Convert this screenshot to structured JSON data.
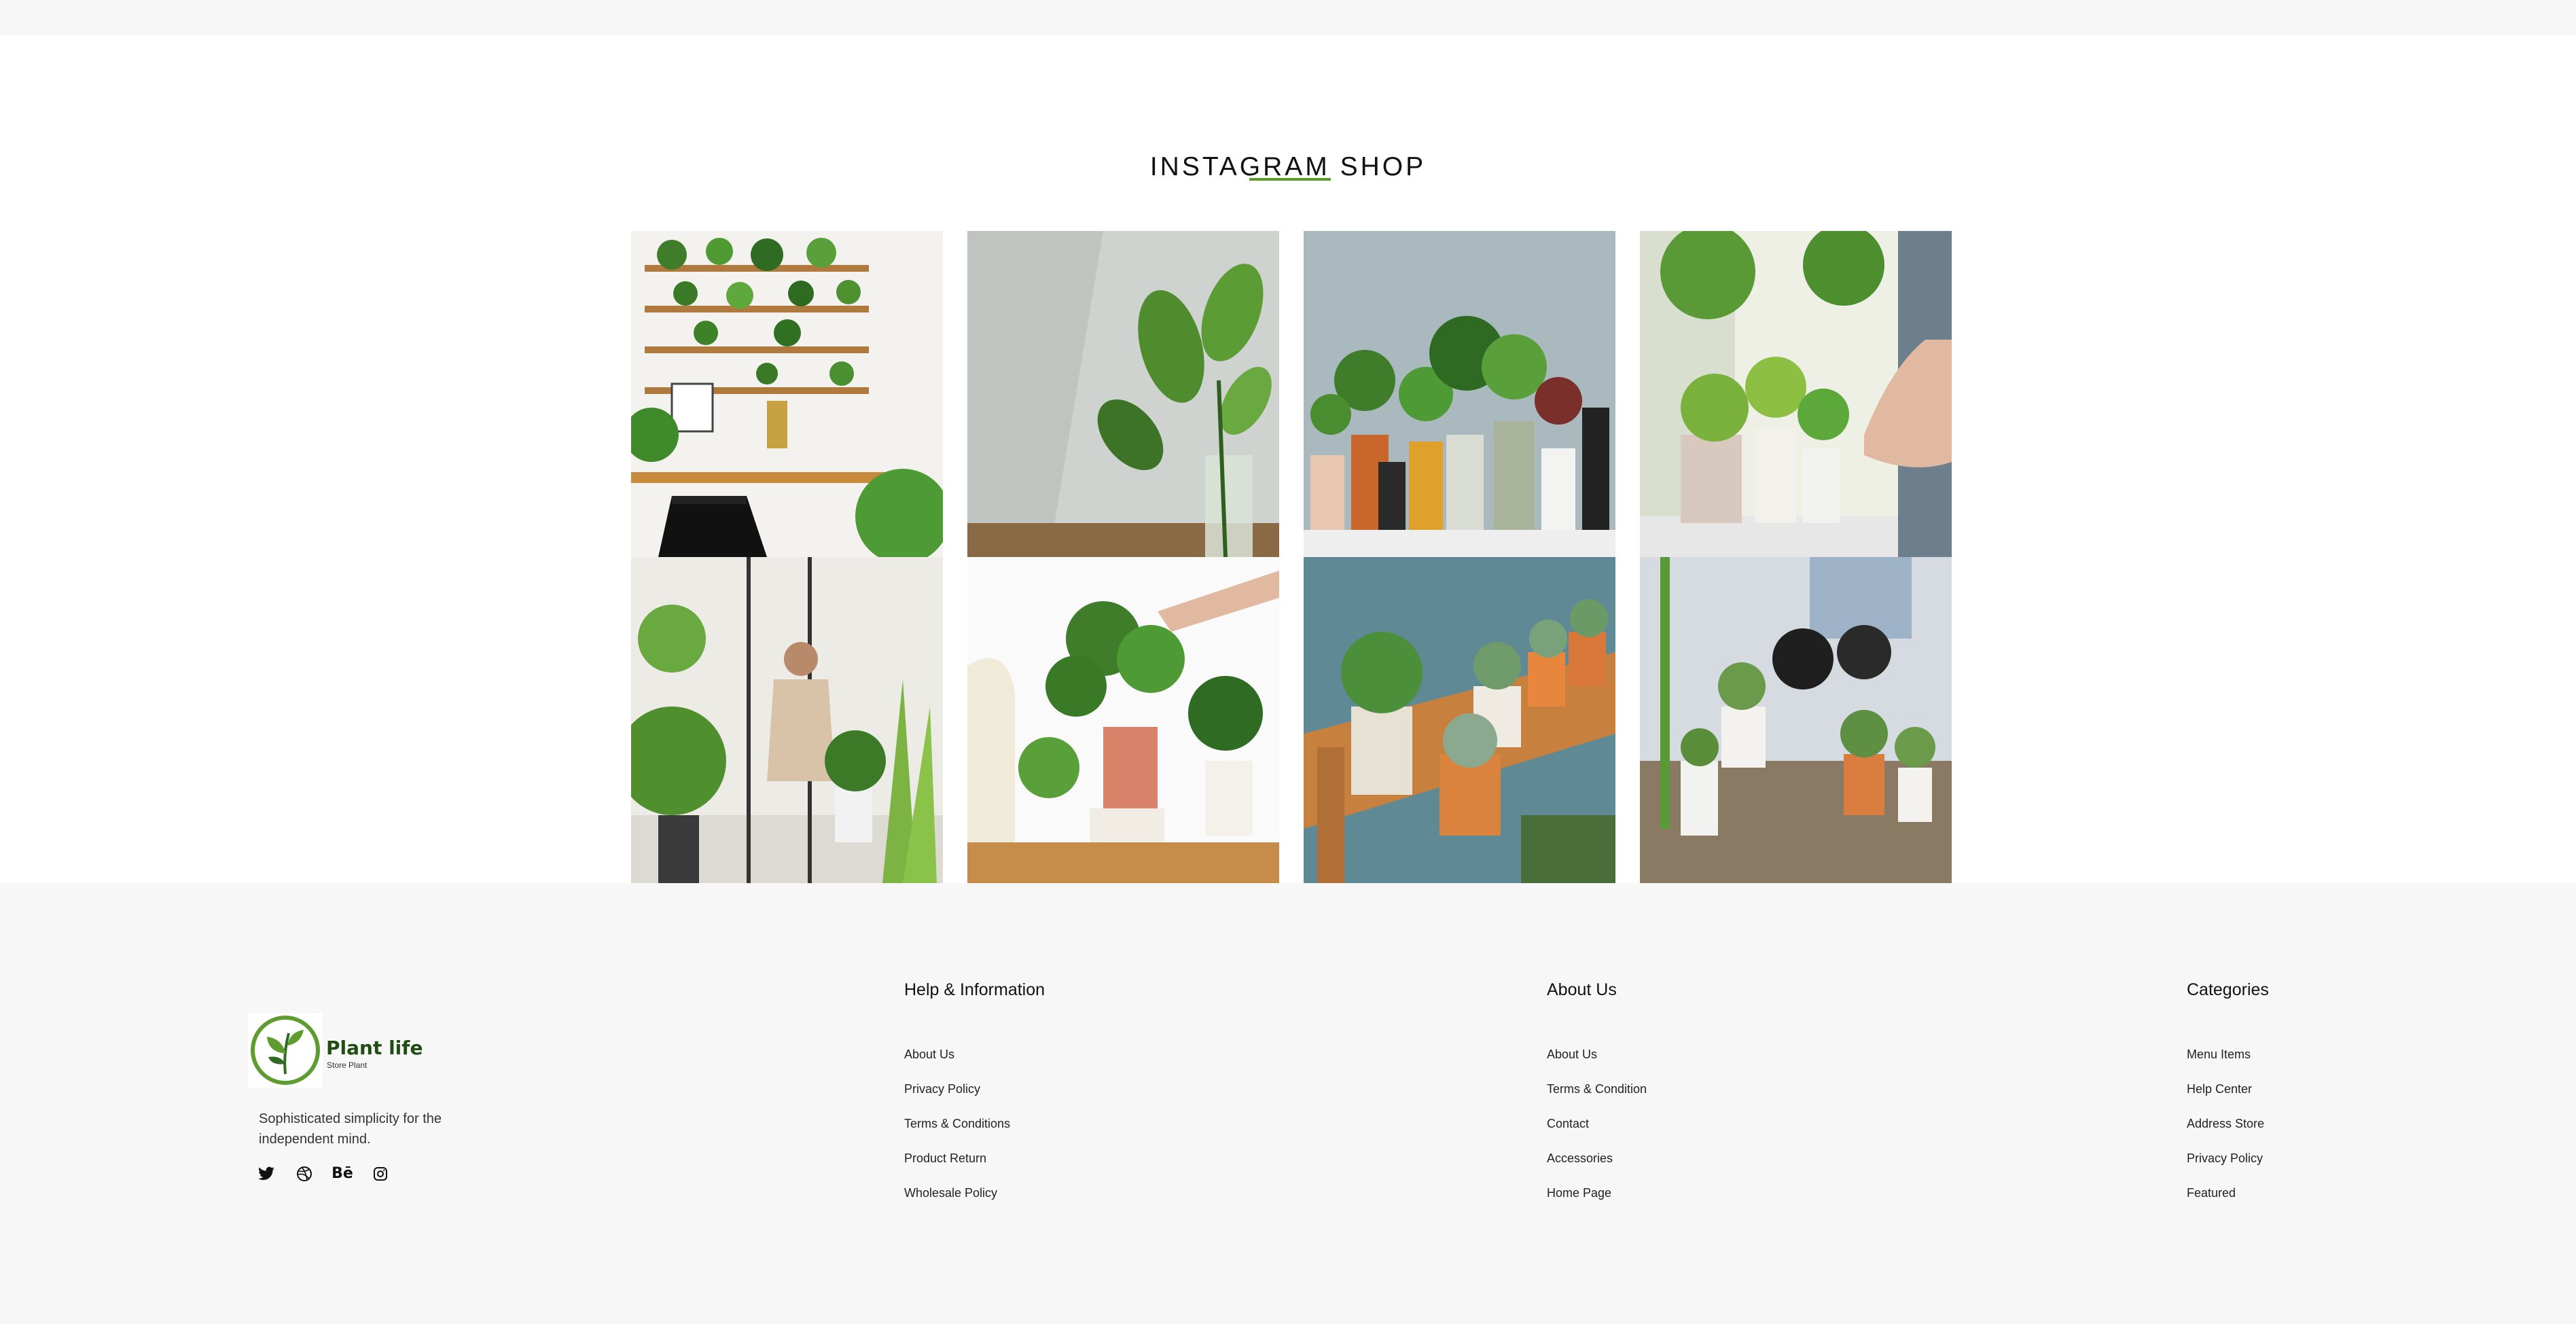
{
  "instagram": {
    "title": "INSTAGRAM SHOP",
    "accent_color": "#5f9c2f",
    "tiles": [
      {
        "name": "plant-shelf-desk-photo"
      },
      {
        "name": "leaf-in-glass-vase-photo"
      },
      {
        "name": "potted-plants-row-photo"
      },
      {
        "name": "hand-arranging-plants-photo"
      },
      {
        "name": "man-tending-plants-photo"
      },
      {
        "name": "hand-watering-monstera-photo"
      },
      {
        "name": "succulents-on-stand-photo"
      },
      {
        "name": "gloved-hands-cactus-photo"
      }
    ]
  },
  "footer": {
    "brand": {
      "name": "Plant life",
      "subtitle": "Store Plant",
      "tagline": "Sophisticated simplicity for the independent mind.",
      "logo_color": "#5f9c2f"
    },
    "socials": [
      {
        "name": "twitter-icon"
      },
      {
        "name": "dribbble-icon"
      },
      {
        "name": "behance-icon",
        "label": "Bē"
      },
      {
        "name": "instagram-icon"
      }
    ],
    "columns": [
      {
        "title": "Help & Information",
        "links": [
          "About Us",
          "Privacy Policy",
          "Terms & Conditions",
          "Product Return",
          "Wholesale Policy"
        ]
      },
      {
        "title": "About Us",
        "links": [
          "About Us",
          "Terms & Condition",
          "Contact",
          "Accessories",
          "Home Page"
        ]
      },
      {
        "title": "Categories",
        "links": [
          "Menu Items",
          "Help Center",
          "Address Store",
          "Privacy Policy",
          "Featured"
        ]
      }
    ]
  }
}
